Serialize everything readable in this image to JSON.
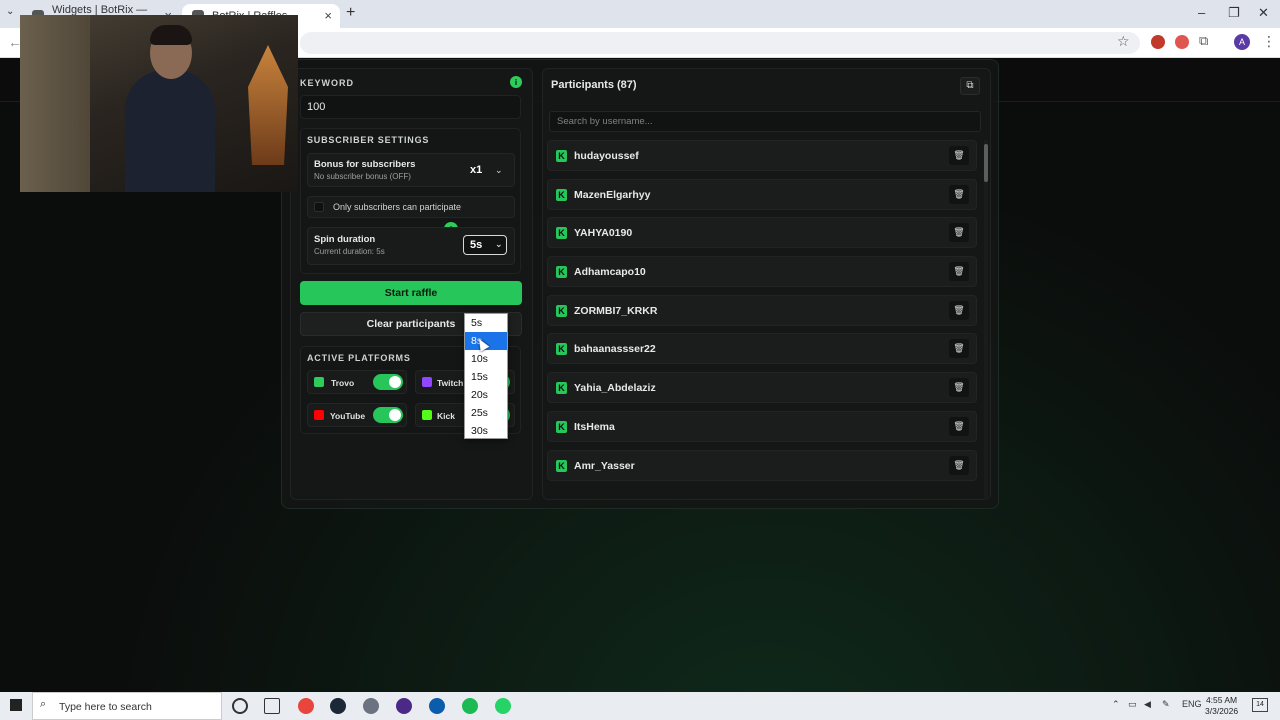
{
  "browser": {
    "tabs": [
      {
        "label": "Widgets | BotRix — Cloud Stre...",
        "active": false
      },
      {
        "label": "BotRix | Raffles",
        "active": true
      }
    ],
    "new_tab": "+"
  },
  "raffle": {
    "keyword_label": "KEYWORD",
    "keyword_value": "100",
    "subscriber_settings_label": "SUBSCRIBER SETTINGS",
    "bonus_title": "Bonus for subscribers",
    "bonus_sub": "No subscriber bonus (OFF)",
    "bonus_multiplier": "x1",
    "only_subscribers_label": "Only subscribers can participate",
    "spin_title": "Spin duration",
    "spin_sub": "Current duration: 5s",
    "spin_value": "5s",
    "spin_options": [
      "5s",
      "8s",
      "10s",
      "15s",
      "20s",
      "25s",
      "30s"
    ],
    "spin_highlighted": "8s",
    "start_button": "Start raffle",
    "clear_button": "Clear participants",
    "platforms_label": "ACTIVE PLATFORMS",
    "platforms": [
      {
        "name": "Trovo",
        "enabled": true,
        "color": "#2ecc5a"
      },
      {
        "name": "Twitch",
        "enabled": true,
        "color": "#9146ff"
      },
      {
        "name": "YouTube",
        "enabled": true,
        "color": "#ff0000"
      },
      {
        "name": "Kick",
        "enabled": true,
        "color": "#53fc18"
      }
    ]
  },
  "participants": {
    "title": "Participants (87)",
    "search_placeholder": "Search by username...",
    "list": [
      "hudayoussef",
      "MazenElgarhyy",
      "YAHYA0190",
      "Adhamcapo10",
      "ZORMBI7_KRKR",
      "bahaanassser22",
      "Yahia_Abdelaziz",
      "ItsHema",
      "Amr_Yasser"
    ]
  },
  "taskbar": {
    "search_placeholder": "Type here to search",
    "language": "ENG",
    "time": "4:55 AM",
    "date": "3/3/2026",
    "notifications": "14"
  },
  "colors": {
    "accent": "#27c65a",
    "background": "#0b0d0c"
  }
}
